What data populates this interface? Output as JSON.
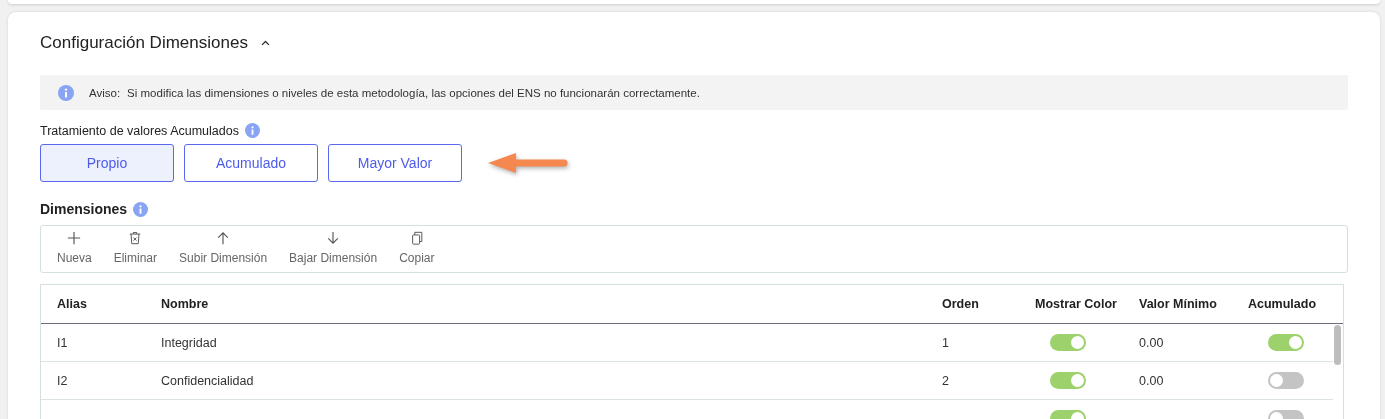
{
  "panel": {
    "title": "Configuración Dimensiones",
    "expanded": true
  },
  "notice": {
    "label": "Aviso:",
    "text": "Si modifica las dimensiones o niveles de esta metodología, las opciones del ENS no funcionarán correctamente."
  },
  "accumulation": {
    "label": "Tratamiento de valores Acumulados",
    "options": [
      {
        "label": "Propio",
        "selected": true
      },
      {
        "label": "Acumulado",
        "selected": false
      },
      {
        "label": "Mayor Valor",
        "selected": false
      }
    ]
  },
  "dimensions": {
    "label": "Dimensiones",
    "toolbar": [
      {
        "label": "Nueva",
        "kind": "add"
      },
      {
        "label": "Eliminar",
        "kind": "delete"
      },
      {
        "label": "Subir Dimensión",
        "kind": "up"
      },
      {
        "label": "Bajar Dimensión",
        "kind": "down"
      },
      {
        "label": "Copiar",
        "kind": "copy"
      }
    ],
    "table": {
      "columns": [
        "Alias",
        "Nombre",
        "Orden",
        "Mostrar Color",
        "Valor Mínimo",
        "Acumulado"
      ],
      "rows": [
        {
          "alias": "I1",
          "name": "Integridad",
          "order": "1",
          "show_color": true,
          "min_value": "0.00",
          "accumulated": true
        },
        {
          "alias": "I2",
          "name": "Confidencialidad",
          "order": "2",
          "show_color": true,
          "min_value": "0.00",
          "accumulated": false
        },
        {
          "show_color": true,
          "accumulated": false
        }
      ]
    }
  }
}
